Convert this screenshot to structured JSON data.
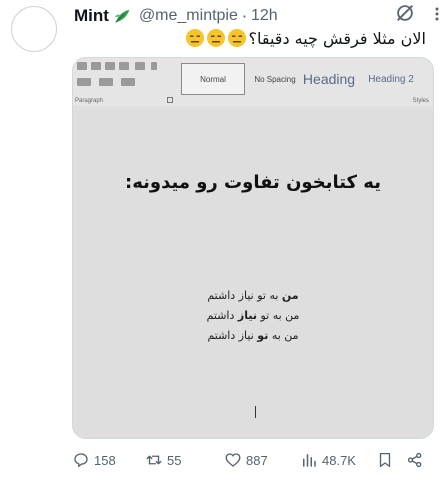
{
  "tweet": {
    "display_name": "Mint",
    "handle": "@me_mintpie",
    "separator": "·",
    "time": "12h",
    "text": "الان مثلا فرقش چیه دقیقا؟",
    "emoji_count": 3,
    "emoji_name": "expressionless-face"
  },
  "media": {
    "ribbon": {
      "styles": [
        "Normal",
        "No Spacing",
        "Heading",
        "Heading 2"
      ],
      "paragraph_label": "Paragraph",
      "styles_label": "Styles"
    },
    "document": {
      "title": "یه کتابخون تفاوت رو میدونه:",
      "lines": [
        {
          "bold": "من",
          "rest": " به تو نیاز داشتم",
          "pre": ""
        },
        {
          "pre": "من به تو ",
          "bold": "نیاز",
          "rest": " داشتم"
        },
        {
          "pre": "من به ",
          "bold": "تو",
          "rest": " نیاز داشتم"
        }
      ]
    }
  },
  "actions": {
    "replies": "158",
    "retweets": "55",
    "likes": "887",
    "views": "48.7K"
  },
  "colors": {
    "text_secondary": "#536471",
    "leaf_green": "#2e9e4f",
    "emoji_yellow": "#f7c52b"
  }
}
